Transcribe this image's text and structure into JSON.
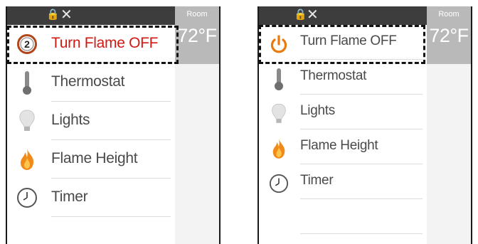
{
  "colors": {
    "topbar": "#3d3d3d",
    "side_panel": "#b9b9b9",
    "accent_red": "#d21a12",
    "power_orange": "#e87a10",
    "flame_orange": "#f08a18"
  },
  "icons": {
    "lock": "🔒",
    "tools": "✕"
  },
  "left_screen": {
    "room_label": "Room",
    "temperature": "72°F",
    "menu": [
      {
        "label": "Turn Flame OFF",
        "icon": "numbered-2-icon",
        "badge": "2"
      },
      {
        "label": "Thermostat",
        "icon": "thermometer-icon"
      },
      {
        "label": "Lights",
        "icon": "lightbulb-icon"
      },
      {
        "label": "Flame Height",
        "icon": "flame-icon"
      },
      {
        "label": "Timer",
        "icon": "clock-icon"
      }
    ]
  },
  "right_screen": {
    "room_label": "Room",
    "temperature": "72°F",
    "menu": [
      {
        "label": "Turn Flame OFF",
        "icon": "power-icon"
      },
      {
        "label": "Thermostat",
        "icon": "thermometer-icon"
      },
      {
        "label": "Lights",
        "icon": "lightbulb-icon"
      },
      {
        "label": "Flame Height",
        "icon": "flame-icon"
      },
      {
        "label": "Timer",
        "icon": "clock-icon"
      }
    ]
  }
}
